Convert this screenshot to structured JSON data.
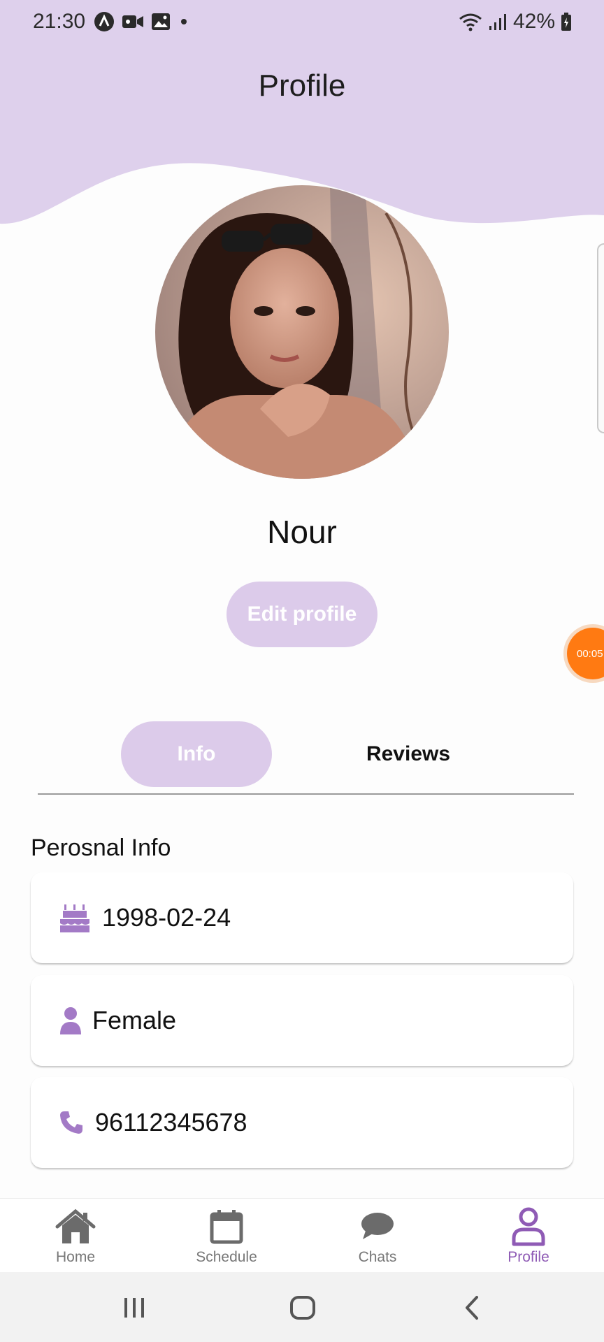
{
  "status_bar": {
    "time": "21:30",
    "battery": "42%",
    "icons_left": [
      "app-a-icon",
      "video-camera-icon",
      "image-icon",
      "dot-icon"
    ],
    "icons_right": [
      "wifi-icon",
      "signal-icon",
      "battery-icon"
    ]
  },
  "header": {
    "title": "Profile",
    "background_color": "#ded0ec"
  },
  "profile": {
    "name": "Nour",
    "avatar": "profile-photo",
    "edit_button_label": "Edit profile"
  },
  "recorder": {
    "label": "00:05"
  },
  "tabs": [
    {
      "label": "Info",
      "active": true
    },
    {
      "label": "Reviews",
      "active": false
    }
  ],
  "personal_info": {
    "section_title": "Perosnal Info",
    "items": [
      {
        "icon": "birthday-cake-icon",
        "value": "1998-02-24"
      },
      {
        "icon": "person-icon",
        "value": "Female"
      },
      {
        "icon": "phone-icon",
        "value": "96112345678"
      }
    ]
  },
  "bottom_nav": {
    "items": [
      {
        "label": "Home",
        "icon": "home-icon",
        "active": false
      },
      {
        "label": "Schedule",
        "icon": "calendar-icon",
        "active": false
      },
      {
        "label": "Chats",
        "icon": "chat-bubble-icon",
        "active": false
      },
      {
        "label": "Profile",
        "icon": "person-outline-icon",
        "active": true
      }
    ]
  },
  "system_nav": [
    "recent-apps-icon",
    "home-circle-icon",
    "back-icon"
  ],
  "colors": {
    "accent": "#a37ac6",
    "accent_light": "#dccbea",
    "active_nav": "#8f5bb5",
    "recorder": "#ff7a12"
  }
}
